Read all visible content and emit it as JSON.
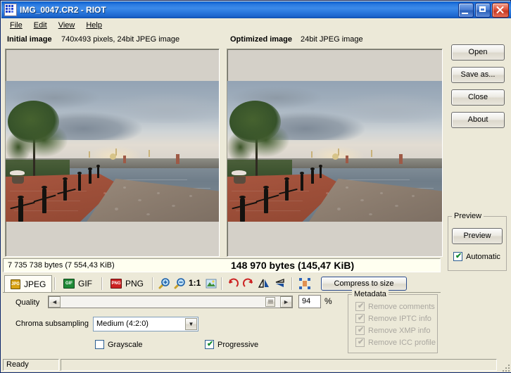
{
  "window": {
    "title": "IMG_0047.CR2 - RIOT",
    "app_icon": "riot-app-icon",
    "minimize_label": "Minimize",
    "maximize_label": "Maximize",
    "close_label": "Close"
  },
  "menu": [
    {
      "label": "File"
    },
    {
      "label": "Edit"
    },
    {
      "label": "View"
    },
    {
      "label": "Help"
    }
  ],
  "panels": {
    "initial": {
      "title": "Initial image",
      "info": "740x493 pixels, 24bit JPEG image",
      "size": "7 735 738 bytes (7 554,43 KiB)"
    },
    "optimized": {
      "title": "Optimized image",
      "info": "24bit JPEG image",
      "size": "148 970 bytes (145,47 KiB)"
    }
  },
  "sidebar": {
    "buttons": [
      {
        "label": "Open"
      },
      {
        "label": "Save as..."
      },
      {
        "label": "Close"
      },
      {
        "label": "About"
      }
    ],
    "preview_group": {
      "title": "Preview",
      "button_label": "Preview",
      "automatic_label": "Automatic",
      "automatic_checked": true
    }
  },
  "tabs": [
    {
      "label": "JPEG",
      "icon": "jpeg-format-icon",
      "active": true,
      "badge": "JPG",
      "color": "#d8a213"
    },
    {
      "label": "GIF",
      "icon": "gif-format-icon",
      "active": false,
      "badge": "GIF",
      "color": "#1f8a36"
    },
    {
      "label": "PNG",
      "icon": "png-format-icon",
      "active": false,
      "badge": "PNG",
      "color": "#cc2222"
    }
  ],
  "toolbar": {
    "zoom_in": "zoom-in-icon",
    "zoom_out": "zoom-out-icon",
    "actual_size_label": "1:1",
    "fit_image": "fit-image-icon",
    "rotate_left": "rotate-left-icon",
    "rotate_right": "rotate-right-icon",
    "flip_horizontal": "flip-horizontal-icon",
    "flip_vertical": "flip-vertical-icon",
    "resize": "resize-image-icon",
    "compress_label": "Compress to size"
  },
  "options": {
    "quality_label": "Quality",
    "quality_value": "94",
    "percent_label": "%",
    "slider_left_arrow": "◄",
    "slider_right_arrow": "►",
    "chroma_label": "Chroma subsampling",
    "chroma_value": "Medium (4:2:0)",
    "chroma_arrow": "▼",
    "grayscale_label": "Grayscale",
    "grayscale_checked": false,
    "progressive_label": "Progressive",
    "progressive_checked": true,
    "metadata": {
      "title": "Metadata",
      "items": [
        {
          "label": "Remove comments",
          "checked": true,
          "enabled": false
        },
        {
          "label": "Remove IPTC info",
          "checked": true,
          "enabled": false
        },
        {
          "label": "Remove XMP info",
          "checked": true,
          "enabled": false
        },
        {
          "label": "Remove ICC profile",
          "checked": true,
          "enabled": false
        }
      ]
    }
  },
  "status": {
    "text": "Ready",
    "second_panel": ""
  },
  "colors": {
    "titlebar_blue": "#2a7ae0",
    "face": "#ece9d8",
    "sunken_field": "#fffff0",
    "check_green": "#128a2e"
  }
}
